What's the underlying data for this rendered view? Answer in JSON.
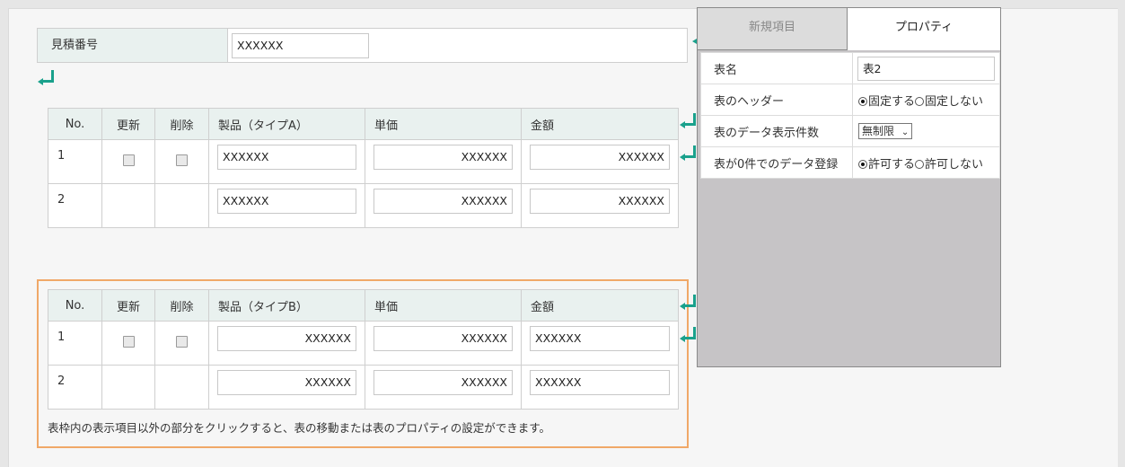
{
  "estimate": {
    "label": "見積番号",
    "value": "XXXXXX"
  },
  "table_a": {
    "headers": [
      "No.",
      "更新",
      "削除",
      "製品（タイプA）",
      "単価",
      "金額"
    ],
    "rows": [
      {
        "no": "1",
        "product": "XXXXXX",
        "price": "XXXXXX",
        "amount": "XXXXXX"
      },
      {
        "no": "2",
        "product": "XXXXXX",
        "price": "XXXXXX",
        "amount": "XXXXXX"
      }
    ]
  },
  "table_b": {
    "headers": [
      "No.",
      "更新",
      "削除",
      "製品（タイプB）",
      "単価",
      "金額"
    ],
    "rows": [
      {
        "no": "1",
        "product": "XXXXXX",
        "price": "XXXXXX",
        "amount": "XXXXXX"
      },
      {
        "no": "2",
        "product": "XXXXXX",
        "price": "XXXXXX",
        "amount": "XXXXXX"
      }
    ],
    "note": "表枠内の表示項目以外の部分をクリックすると、表の移動または表のプロパティの設定ができます。"
  },
  "panel": {
    "tabs": [
      "新規項目",
      "プロパティ"
    ],
    "active_tab": 1,
    "rows": {
      "table_name_label": "表名",
      "table_name_value": "表2",
      "header_label": "表のヘッダー",
      "header_opt_fixed": "固定する",
      "header_opt_unfixed": "固定しない",
      "count_label": "表のデータ表示件数",
      "count_value": "無制限",
      "zero_label": "表が0件でのデータ登録",
      "zero_opt_allow": "許可する",
      "zero_opt_deny": "許可しない"
    }
  },
  "colors": {
    "accent_teal": "#1aa18c",
    "selection_orange": "#f0a868",
    "header_bg": "#e9f1ef"
  },
  "icons": [
    "return-arrow-icon",
    "chevron-down-icon"
  ]
}
